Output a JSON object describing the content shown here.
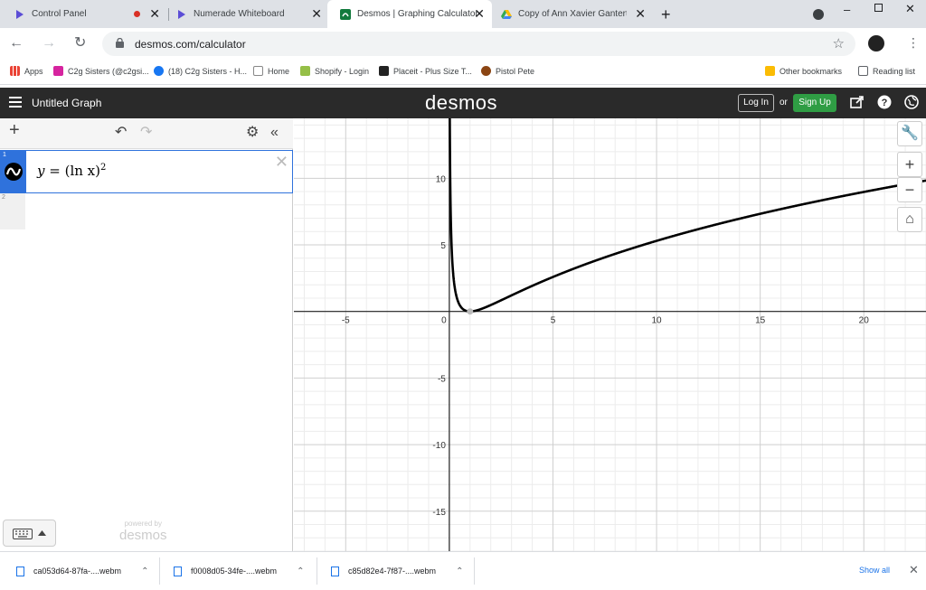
{
  "browser": {
    "tabs": [
      {
        "title": "Control Panel",
        "recording": true
      },
      {
        "title": "Numerade Whiteboard"
      },
      {
        "title": "Desmos | Graphing Calculator",
        "active": true
      },
      {
        "title": "Copy of Ann Xavier Gantert - A"
      }
    ],
    "new_tab": "+",
    "url": "desmos.com/calculator",
    "bookmarks": [
      {
        "label": "Apps",
        "icon": "apps-grid-icon"
      },
      {
        "label": "C2g Sisters (@c2gsi...",
        "icon": "instagram-icon"
      },
      {
        "label": "(18) C2g Sisters - H...",
        "icon": "facebook-icon"
      },
      {
        "label": "Home",
        "icon": "home-bookmark-icon"
      },
      {
        "label": "Shopify - Login",
        "icon": "shopify-icon"
      },
      {
        "label": "Placeit - Plus Size T...",
        "icon": "placeit-icon"
      },
      {
        "label": "Pistol Pete",
        "icon": "pistol-pete-icon"
      }
    ],
    "other_bookmarks": "Other bookmarks",
    "reading_list": "Reading list"
  },
  "desmos": {
    "graph_title": "Untitled Graph",
    "logo": "desmos",
    "login": "Log In",
    "or": "or",
    "signup": "Sign Up",
    "expressions": [
      {
        "index": "1",
        "latex_lhs": "y = ",
        "latex_rhs": "(ln x)",
        "exponent": "2"
      },
      {
        "index": "2"
      }
    ],
    "powered_by": "powered by",
    "powered_logo": "desmos"
  },
  "chart_data": {
    "type": "line",
    "function": "y = (ln x)^2",
    "xlim": [
      -7.5,
      23
    ],
    "ylim": [
      -18,
      14.5
    ],
    "x_ticks": [
      -5,
      0,
      5,
      10,
      15,
      20
    ],
    "y_ticks": [
      -15,
      -10,
      -5,
      5,
      10
    ],
    "x_tick_labels": [
      "-5",
      "0",
      "5",
      "10",
      "15",
      "20"
    ],
    "y_tick_labels": [
      "-15",
      "-10",
      "-5",
      "5",
      "10"
    ],
    "point_of_interest": {
      "x": 1,
      "y": 0
    },
    "grid": true
  },
  "downloads": {
    "items": [
      {
        "name": "ca053d64-87fa-....webm"
      },
      {
        "name": "f0008d05-34fe-....webm"
      },
      {
        "name": "c85d82e4-7f87-....webm"
      }
    ],
    "show_all": "Show all"
  }
}
